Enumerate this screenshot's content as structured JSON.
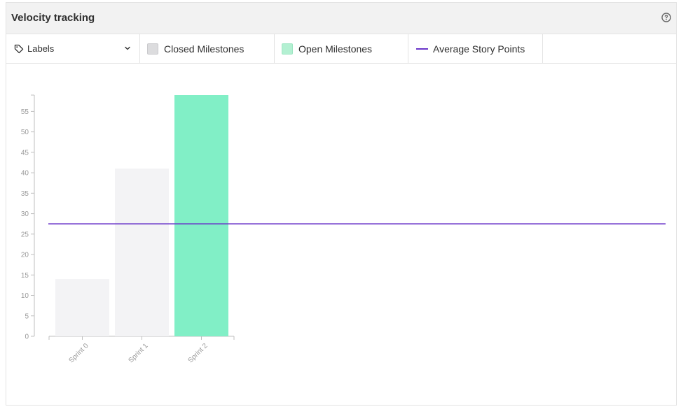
{
  "header": {
    "title": "Velocity tracking",
    "help_icon": "question-circle-icon"
  },
  "toolbar": {
    "dropdown": {
      "label": "Labels",
      "icon": "tag-icon",
      "chevron_icon": "chevron-down-icon"
    },
    "legend": [
      {
        "label": "Closed Milestones",
        "kind": "swatch",
        "fill": "#dcdcde",
        "stroke": "#c9c9cc"
      },
      {
        "label": "Open Milestones",
        "kind": "swatch",
        "fill": "#b3f0d2",
        "stroke": "#9ee6c3"
      },
      {
        "label": "Average Story Points",
        "kind": "line",
        "fill": "#6934c9"
      }
    ]
  },
  "colors": {
    "closed_bar": "#f3f3f5",
    "open_bar": "#81efc6",
    "average_line": "#6934c9"
  },
  "chart_data": {
    "type": "bar",
    "categories": [
      "Sprint 0",
      "Sprint 1",
      "Sprint 2"
    ],
    "series": [
      {
        "name": "Closed Milestones",
        "values": [
          14,
          41,
          0
        ]
      },
      {
        "name": "Open Milestones",
        "values": [
          0,
          0,
          59
        ]
      }
    ],
    "average": {
      "name": "Average Story Points",
      "value": 27.5
    },
    "yticks": [
      0,
      5,
      10,
      15,
      20,
      25,
      30,
      35,
      40,
      45,
      50,
      55
    ],
    "ylim": [
      0,
      59
    ],
    "title": "",
    "xlabel": "",
    "ylabel": "",
    "grid": false,
    "legend": "top"
  }
}
